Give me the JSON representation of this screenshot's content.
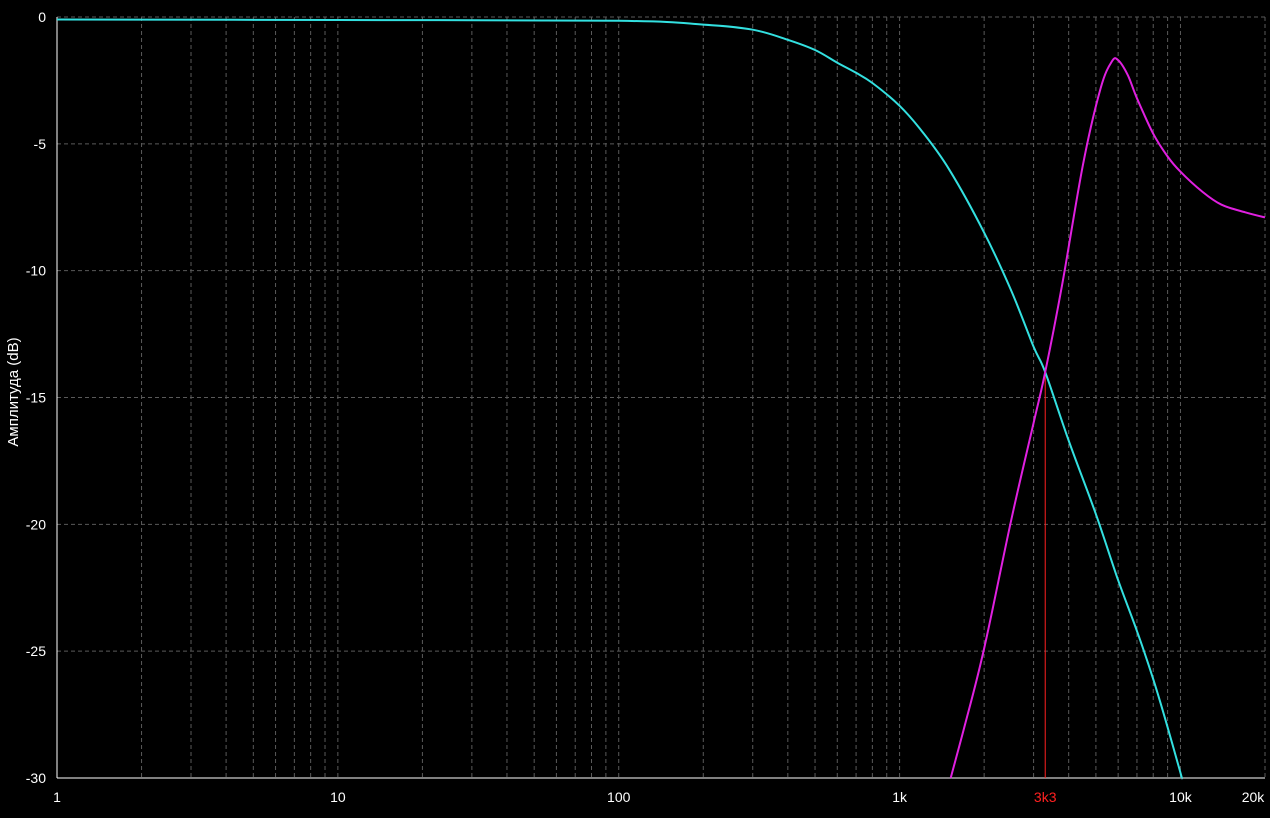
{
  "chart_data": {
    "type": "line",
    "title": "",
    "xlabel": "",
    "ylabel": "Амплитуда (dB)",
    "x_scale": "log",
    "xlim": [
      1,
      20000
    ],
    "ylim": [
      -30,
      0
    ],
    "grid": true,
    "x_ticks": [
      {
        "value": 1,
        "label": "1"
      },
      {
        "value": 10,
        "label": "10"
      },
      {
        "value": 100,
        "label": "100"
      },
      {
        "value": 1000,
        "label": "1k"
      },
      {
        "value": 10000,
        "label": "10k"
      },
      {
        "value": 20000,
        "label": "20k"
      }
    ],
    "y_ticks": [
      {
        "value": 0,
        "label": "0"
      },
      {
        "value": -5,
        "label": "-5"
      },
      {
        "value": -10,
        "label": "-10"
      },
      {
        "value": -15,
        "label": "-15"
      },
      {
        "value": -20,
        "label": "-20"
      },
      {
        "value": -25,
        "label": "-25"
      },
      {
        "value": -30,
        "label": "-30"
      }
    ],
    "crossover_marker": {
      "value": 3300,
      "label": "3k3",
      "color": "#ff2020"
    },
    "series": [
      {
        "color": "#33e0e0",
        "points": [
          [
            1,
            -0.1
          ],
          [
            10,
            -0.12
          ],
          [
            100,
            -0.15
          ],
          [
            200,
            -0.3
          ],
          [
            300,
            -0.5
          ],
          [
            400,
            -0.9
          ],
          [
            500,
            -1.3
          ],
          [
            600,
            -1.8
          ],
          [
            700,
            -2.2
          ],
          [
            800,
            -2.6
          ],
          [
            1000,
            -3.5
          ],
          [
            1200,
            -4.5
          ],
          [
            1500,
            -6.0
          ],
          [
            2000,
            -8.5
          ],
          [
            2500,
            -10.8
          ],
          [
            3000,
            -13.0
          ],
          [
            3300,
            -14.0
          ],
          [
            4000,
            -16.7
          ],
          [
            5000,
            -19.6
          ],
          [
            6000,
            -22.2
          ],
          [
            7000,
            -24.2
          ],
          [
            8000,
            -26.1
          ],
          [
            9000,
            -28.0
          ],
          [
            10000,
            -29.8
          ],
          [
            10120,
            -30.0
          ]
        ]
      },
      {
        "color": "#e020e0",
        "points": [
          [
            1520,
            -30.0
          ],
          [
            1700,
            -28.0
          ],
          [
            2000,
            -24.9
          ],
          [
            2500,
            -19.8
          ],
          [
            3000,
            -16.0
          ],
          [
            3300,
            -14.0
          ],
          [
            3800,
            -10.5
          ],
          [
            4500,
            -5.8
          ],
          [
            5200,
            -2.8
          ],
          [
            5700,
            -1.75
          ],
          [
            6000,
            -1.7
          ],
          [
            6500,
            -2.3
          ],
          [
            7000,
            -3.2
          ],
          [
            8000,
            -4.6
          ],
          [
            9000,
            -5.5
          ],
          [
            10000,
            -6.1
          ],
          [
            12000,
            -6.9
          ],
          [
            14000,
            -7.4
          ],
          [
            17000,
            -7.7
          ],
          [
            20000,
            -7.9
          ]
        ]
      }
    ]
  }
}
